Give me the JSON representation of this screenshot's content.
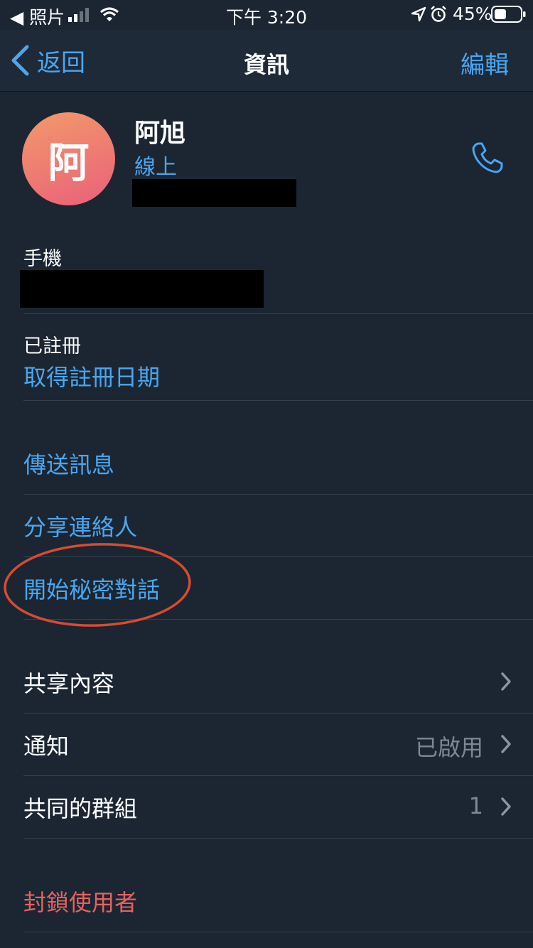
{
  "status_bar": {
    "back_app": "◀ 照片",
    "time": "下午 3:20",
    "battery": "45%"
  },
  "nav": {
    "back_label": "返回",
    "title": "資訊",
    "edit_label": "編輯"
  },
  "profile": {
    "avatar_initial": "阿",
    "name": "阿旭",
    "status": "線上"
  },
  "phone": {
    "label": "手機"
  },
  "registered": {
    "label": "已註冊",
    "value": "取得註冊日期"
  },
  "actions": {
    "send_message": "傳送訊息",
    "share_contact": "分享連絡人",
    "start_secret_chat": "開始秘密對話"
  },
  "settings": {
    "shared_content": "共享內容",
    "notifications": "通知",
    "notifications_value": "已啟用",
    "common_groups": "共同的群組",
    "common_groups_value": "1"
  },
  "block": {
    "label": "封鎖使用者"
  },
  "colors": {
    "background": "#1b2632",
    "accent": "#4aa6f0",
    "destructive": "#e5635f",
    "annotation": "#d94a32"
  }
}
